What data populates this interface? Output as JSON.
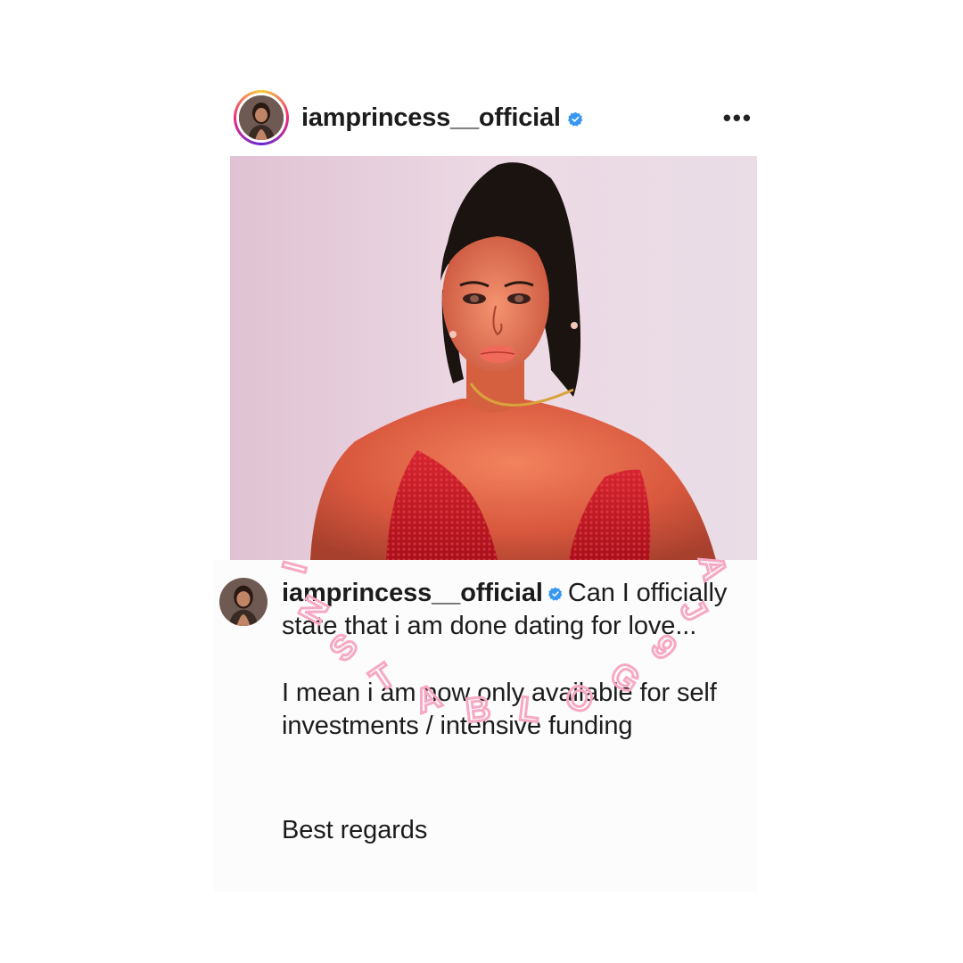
{
  "post": {
    "username": "iamprincess__official",
    "verified_icon": "verified-badge-icon",
    "more_icon": "more-options-icon",
    "more_label": "•••"
  },
  "caption": {
    "username": "iamprincess__official",
    "line1": "Can I officially state that i am done dating for love...",
    "line2": "I mean i am now only available for self investments / intensive funding",
    "line3": "Best regards"
  },
  "watermark": {
    "text": "INSTABLOG9JA"
  },
  "colors": {
    "verified_blue": "#3897f0",
    "watermark_pink": "#f7a8c4",
    "photo_bg": "#e7d3df",
    "dress_red": "#c8161e"
  }
}
